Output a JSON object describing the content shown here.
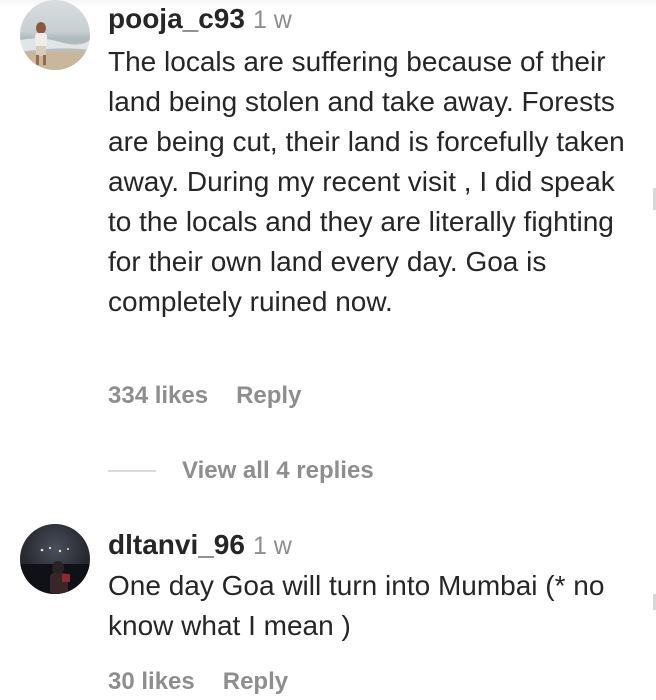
{
  "comments": [
    {
      "username": "pooja_c93",
      "time": "1 w",
      "text": "The locals are suffering because of their land being stolen and take away. Forests are being cut, their land is forcefully taken away. During my recent visit , I did speak to the locals and they are literally fighting for their own land every day. Goa is completely ruined now.",
      "likes": "334 likes",
      "reply_label": "Reply",
      "view_replies_label": "View all 4 replies"
    },
    {
      "username": "dltanvi_96",
      "time": "1 w",
      "text": "One day Goa will turn into Mumbai (* no know what I mean )",
      "likes": "30 likes",
      "reply_label": "Reply"
    }
  ]
}
